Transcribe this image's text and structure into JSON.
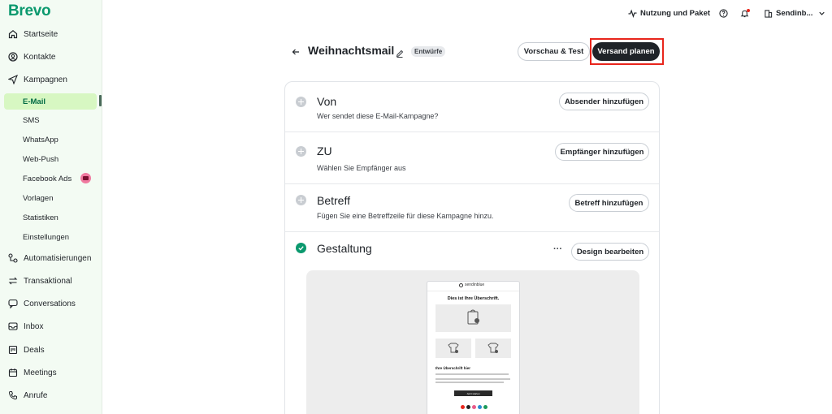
{
  "app": {
    "logo": "Brevo",
    "brand_color": "#0b996e"
  },
  "sidebar": {
    "items": [
      {
        "label": "Startseite",
        "icon": "home-icon"
      },
      {
        "label": "Kontakte",
        "icon": "contacts-icon"
      },
      {
        "label": "Kampagnen",
        "icon": "send-icon"
      }
    ],
    "campaign_subitems": [
      {
        "label": "E-Mail",
        "active": true
      },
      {
        "label": "SMS"
      },
      {
        "label": "WhatsApp"
      },
      {
        "label": "Web-Push"
      },
      {
        "label": "Facebook Ads",
        "badge_icon": "robot-icon"
      },
      {
        "label": "Vorlagen"
      },
      {
        "label": "Statistiken"
      },
      {
        "label": "Einstellungen"
      }
    ],
    "items_lower": [
      {
        "label": "Automatisierungen",
        "icon": "automation-icon"
      },
      {
        "label": "Transaktional",
        "icon": "transactional-icon"
      },
      {
        "label": "Conversations",
        "icon": "chat-icon"
      },
      {
        "label": "Inbox",
        "icon": "inbox-icon"
      },
      {
        "label": "Deals",
        "icon": "deals-icon"
      },
      {
        "label": "Meetings",
        "icon": "calendar-icon"
      },
      {
        "label": "Anrufe",
        "icon": "phone-icon"
      }
    ]
  },
  "topbar": {
    "plan_label": "Nutzung und Paket",
    "account_label": "Sendinb..."
  },
  "header": {
    "title": "Weihnachtsmail",
    "status": "Entwürfe",
    "preview_button": "Vorschau & Test",
    "schedule_button": "Versand planen"
  },
  "sections": [
    {
      "title": "Von",
      "subtitle": "Wer sendet diese E-Mail-Kampagne?",
      "button": "Absender hinzufügen",
      "done": false
    },
    {
      "title": "ZU",
      "subtitle": "Wählen Sie Empfänger aus",
      "button": "Empfänger hinzufügen",
      "done": false
    },
    {
      "title": "Betreff",
      "subtitle": "Fügen Sie eine Betreffzeile für diese Kampagne hinzu.",
      "button": "Betreff hinzufügen",
      "done": false
    },
    {
      "title": "Gestaltung",
      "subtitle": "",
      "button": "Design bearbeiten",
      "done": true,
      "more_label": "···"
    }
  ],
  "preview": {
    "logo": "sendinblue",
    "heading": "Dies ist Ihre Überschrift.",
    "subheading": "Ihre Überschrift hier",
    "button": "Jetzt starten"
  }
}
